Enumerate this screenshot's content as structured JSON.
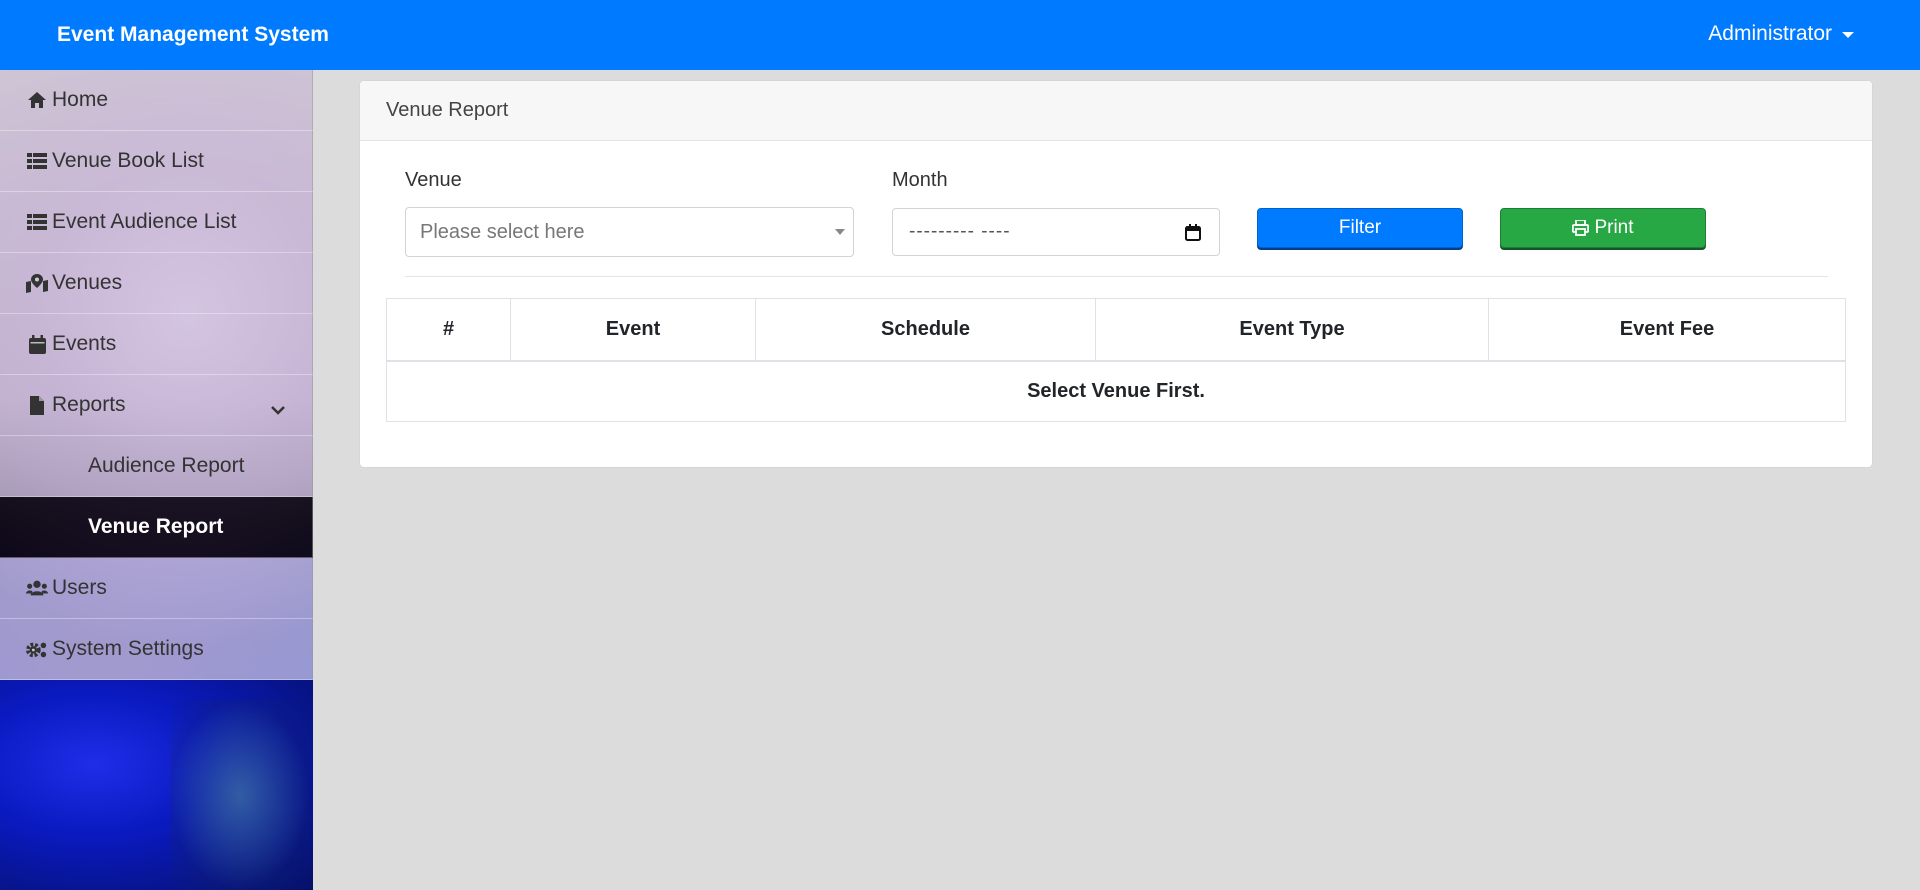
{
  "app": {
    "title": "Event Management System",
    "user": "Administrator"
  },
  "sidebar": {
    "items": [
      {
        "label": "Home",
        "icon": "home-icon"
      },
      {
        "label": "Venue Book List",
        "icon": "list-icon"
      },
      {
        "label": "Event Audience List",
        "icon": "list-icon"
      },
      {
        "label": "Venues",
        "icon": "map-marked-icon"
      },
      {
        "label": "Events",
        "icon": "calendar-icon"
      },
      {
        "label": "Reports",
        "icon": "file-icon"
      },
      {
        "label": "Audience Report"
      },
      {
        "label": "Venue Report",
        "active": true
      },
      {
        "label": "Users",
        "icon": "users-icon"
      },
      {
        "label": "System Settings",
        "icon": "cogs-icon"
      }
    ]
  },
  "report": {
    "header": "Venue Report",
    "venue_label": "Venue",
    "venue_placeholder": "Please select here",
    "month_label": "Month",
    "month_value": "--------- ----",
    "filter_label": "Filter",
    "print_label": "Print",
    "columns": [
      "#",
      "Event",
      "Schedule",
      "Event Type",
      "Event Fee"
    ],
    "empty_message": "Select Venue First."
  },
  "colors": {
    "navbar": "#007bff",
    "filter_button": "#007bff",
    "print_button": "#28a745"
  }
}
